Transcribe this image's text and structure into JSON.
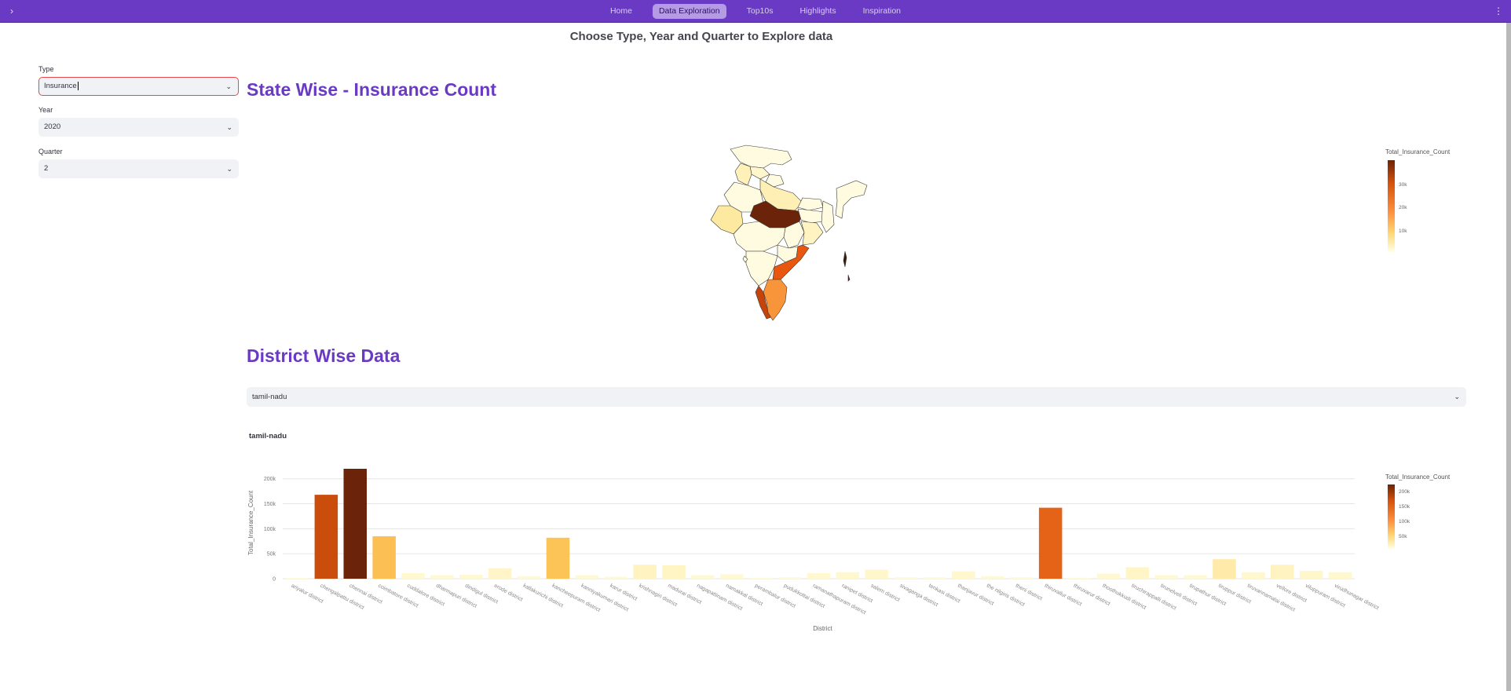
{
  "nav": {
    "items": [
      "Home",
      "Data Exploration",
      "Top10s",
      "Highlights",
      "Inspiration"
    ],
    "active_index": 1
  },
  "page": {
    "heading": "Choose Type, Year and Quarter to Explore data"
  },
  "filters": {
    "type_label": "Type",
    "type_value": "Insurance",
    "year_label": "Year",
    "year_value": "2020",
    "quarter_label": "Quarter",
    "quarter_value": "2"
  },
  "map_section": {
    "title": "State Wise - Insurance Count",
    "legend_title": "Total_Insurance_Count",
    "legend_ticks": [
      "30k",
      "20k",
      "10k"
    ]
  },
  "district_section": {
    "title": "District Wise Data",
    "state_value": "tamil-nadu"
  },
  "colors": {
    "accent": "#6a3ac4",
    "scale": [
      "#fffbd9",
      "#fed976",
      "#fd8d3c",
      "#e8560f",
      "#b33b05",
      "#6b2409"
    ]
  },
  "chart_data": {
    "type": "bar",
    "title": "tamil-nadu",
    "xlabel": "District",
    "ylabel": "Total_Insurance_Count",
    "ylim": [
      0,
      220000
    ],
    "yticks": [
      0,
      50000,
      100000,
      150000,
      200000
    ],
    "ytick_labels": [
      "0",
      "50k",
      "100k",
      "150k",
      "200k"
    ],
    "legend_title": "Total_Insurance_Count",
    "legend_ticks": [
      "200k",
      "150k",
      "100k",
      "50k"
    ],
    "categories": [
      "ariyalur district",
      "chengalpattu district",
      "chennai district",
      "coimbatore district",
      "cuddalore district",
      "dharmapuri district",
      "dindigul district",
      "erode district",
      "kallakurichi district",
      "kancheepuram district",
      "kanniyakumari district",
      "karur district",
      "krishnagiri district",
      "madurai district",
      "nagapattinam district",
      "namakkal district",
      "perambalur district",
      "pudukkottai district",
      "ramanathapuram district",
      "ranipet district",
      "salem district",
      "sivaganga district",
      "tenkasi district",
      "thanjavur district",
      "the nilgiris district",
      "theni district",
      "thiruvallur district",
      "thiruvarur district",
      "thoothukkudi district",
      "tiruchirappalli district",
      "tirunelveli district",
      "tirupathur district",
      "tiruppur district",
      "tiruvannamalai district",
      "vellore district",
      "viluppuram district",
      "virudhunagar district"
    ],
    "values": [
      1500,
      168000,
      220000,
      85000,
      11000,
      7000,
      8000,
      21000,
      5000,
      82000,
      7000,
      4000,
      28000,
      27000,
      7000,
      9000,
      2000,
      3000,
      11000,
      13000,
      18000,
      3000,
      3000,
      15000,
      5000,
      3000,
      142000,
      2000,
      10000,
      23000,
      7000,
      7000,
      39000,
      13000,
      28000,
      16000,
      13000
    ]
  }
}
